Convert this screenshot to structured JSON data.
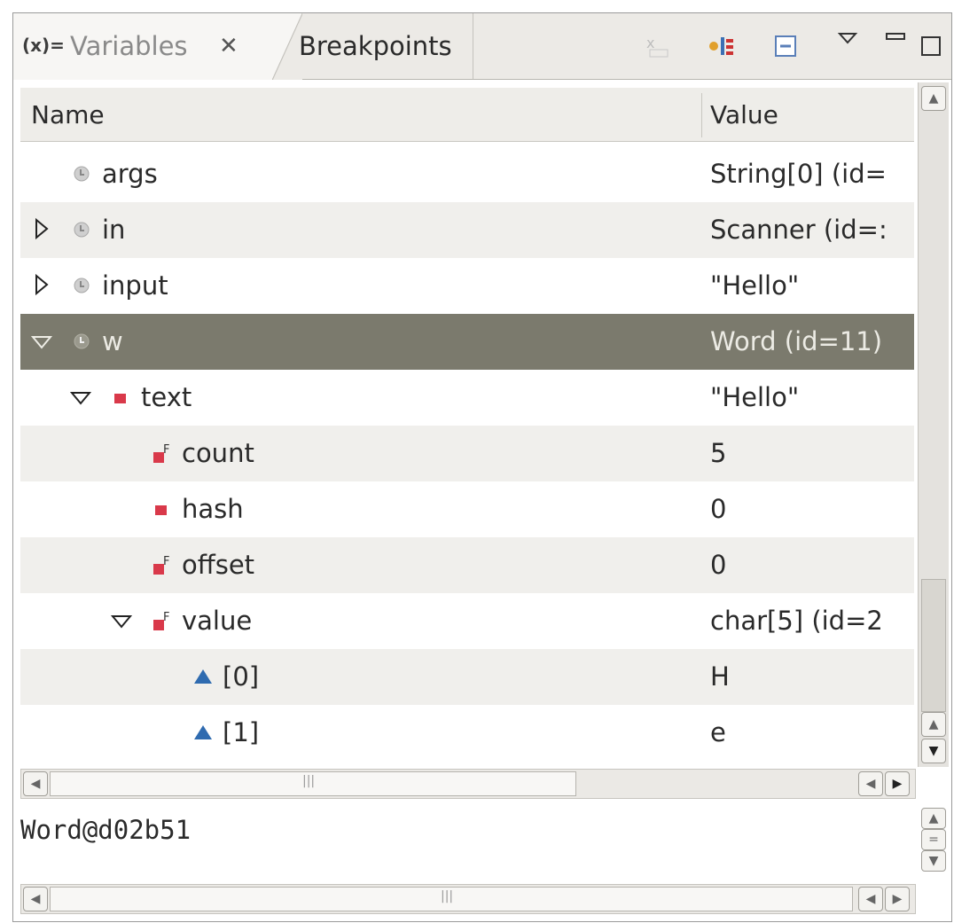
{
  "tabs": [
    {
      "label": "Variables",
      "icon": "variables-icon",
      "active": true
    },
    {
      "label": "Breakpoints",
      "active": false
    }
  ],
  "columns": {
    "name": "Name",
    "value": "Value"
  },
  "rows": [
    {
      "name": "args",
      "value": "String[0]  (id=",
      "depth": 0,
      "twisty": "none",
      "icon": "local-variable-icon"
    },
    {
      "name": "in",
      "value": "Scanner  (id=:",
      "depth": 0,
      "twisty": "collapsed",
      "icon": "local-variable-icon"
    },
    {
      "name": "input",
      "value": "\"Hello\"",
      "depth": 0,
      "twisty": "collapsed",
      "icon": "local-variable-icon"
    },
    {
      "name": "w",
      "value": "Word  (id=11)",
      "depth": 0,
      "twisty": "expanded",
      "icon": "local-variable-icon",
      "selected": true
    },
    {
      "name": "text",
      "value": "\"Hello\"",
      "depth": 1,
      "twisty": "expanded",
      "icon": "private-field-icon"
    },
    {
      "name": "count",
      "value": "5",
      "depth": 2,
      "twisty": "none",
      "icon": "private-final-field-icon"
    },
    {
      "name": "hash",
      "value": "0",
      "depth": 2,
      "twisty": "none",
      "icon": "private-field-icon"
    },
    {
      "name": "offset",
      "value": "0",
      "depth": 2,
      "twisty": "none",
      "icon": "private-final-field-icon"
    },
    {
      "name": "value",
      "value": "char[5]  (id=2",
      "depth": 2,
      "twisty": "expanded",
      "icon": "private-final-field-icon"
    },
    {
      "name": "[0]",
      "value": "H",
      "depth": 3,
      "twisty": "none",
      "icon": "array-element-icon"
    },
    {
      "name": "[1]",
      "value": "e",
      "depth": 3,
      "twisty": "none",
      "icon": "array-element-icon"
    }
  ],
  "detail_text": "Word@d02b51",
  "colors": {
    "selection": "#7b7a6d",
    "field_red": "#d9394a",
    "array_blue": "#2f6bb0"
  }
}
